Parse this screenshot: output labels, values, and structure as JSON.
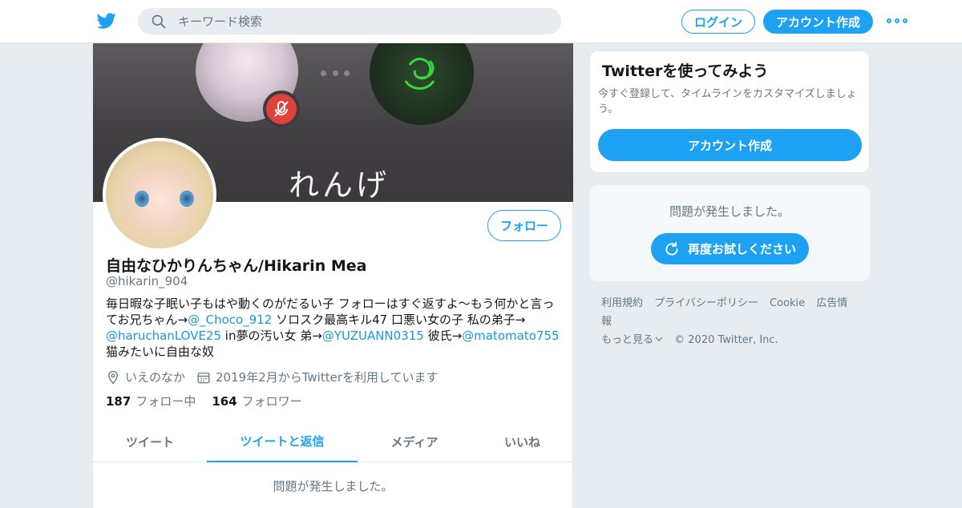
{
  "topbar": {
    "logo_icon": "twitter-bird-icon",
    "search_placeholder": "キーワード検索",
    "login_label": "ログイン",
    "signup_label": "アカウント作成",
    "more_icon": "more-dots-icon"
  },
  "banner": {
    "art_text": "れんげ"
  },
  "profile": {
    "follow_label": "フォロー",
    "display_name": "自由なひかりんちゃん/Hikarin Mea",
    "handle": "@hikarin_904",
    "bio": {
      "t1": "毎日暇な子眠い子もはや動くのがだるい子 フォローはすぐ返すよ〜もう何かと言ってお兄ちゃん→",
      "m1": "@_Choco_912",
      "t2": " ソロスク最高キル47 口悪い女の子 私の弟子→",
      "m2": "@haruchanLOVE25",
      "t3": " in夢の汚い女 弟→",
      "m3": "@YUZUANN0315",
      "t4": " 彼氏→",
      "m4": "@matomato755",
      "t5": " 猫みたいに自由な奴"
    },
    "location": "いえのなか",
    "joined": "2019年2月からTwitterを利用しています",
    "following_count": "187",
    "following_label": "フォロー中",
    "followers_count": "164",
    "followers_label": "フォロワー"
  },
  "tabs": [
    {
      "label": "ツイート"
    },
    {
      "label": "ツイートと返信"
    },
    {
      "label": "メディア"
    },
    {
      "label": "いいね"
    }
  ],
  "feed": {
    "error": "問題が発生しました。"
  },
  "signup_card": {
    "title": "Twitterを使ってみよう",
    "desc": "今すぐ登録して、タイムラインをカスタマイズしましょう。",
    "button": "アカウント作成"
  },
  "error_card": {
    "message": "問題が発生しました。",
    "retry": "再度お試しください"
  },
  "footer": {
    "links": [
      "利用規約",
      "プライバシーポリシー",
      "Cookie",
      "広告情報",
      "もっと見る"
    ],
    "copyright": "© 2020 Twitter, Inc."
  },
  "colors": {
    "accent": "#1da1f2",
    "mention": "#1b95e0",
    "muted": "#657786",
    "background": "#e6ecf0"
  }
}
